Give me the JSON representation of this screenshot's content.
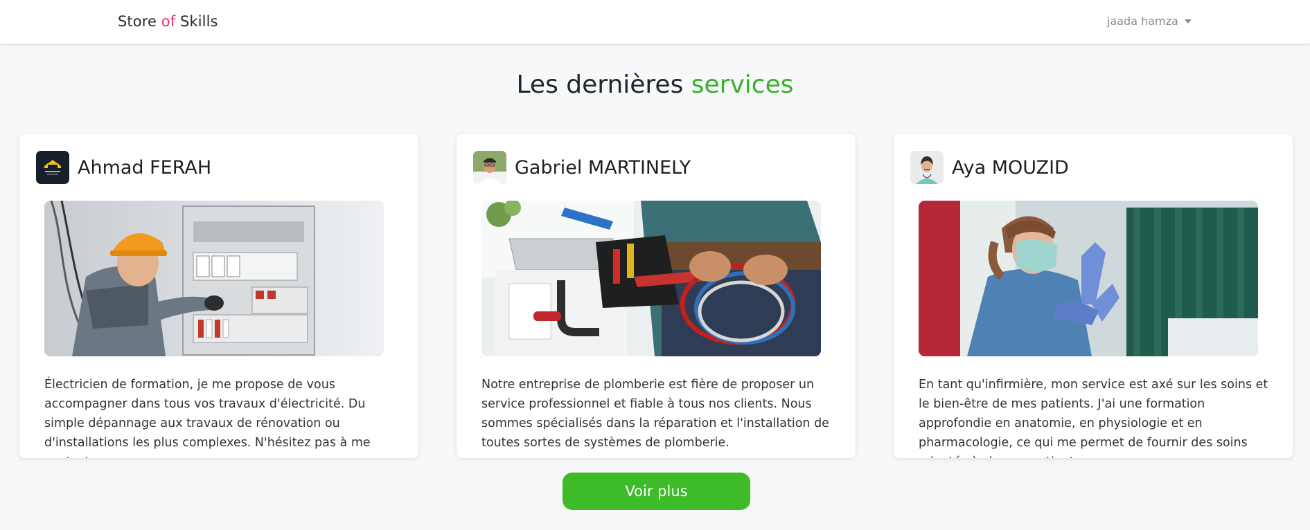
{
  "navbar": {
    "brand_part1": "Store ",
    "brand_accent": "of",
    "brand_part2": " Skills",
    "user_name": "jaada hamza",
    "brand_accent_color": "#e8316f"
  },
  "section": {
    "title_part1": "Les dernières ",
    "title_accent": "services",
    "accent_color": "#3dae2b"
  },
  "cards": [
    {
      "name": "Ahmad FERAH",
      "avatar": "company-logo-icon",
      "image": "electrician-photo",
      "description": "Électricien de formation, je me propose de vous accompagner dans tous vos travaux d'électricité. Du simple dépannage aux travaux de rénovation ou d'installations les plus complexes. N'hésitez pas à me contacter"
    },
    {
      "name": "Gabriel MARTINELY",
      "avatar": "person-photo-icon",
      "image": "plumber-photo",
      "description": "Notre entreprise de plomberie est fière de proposer un service professionnel et fiable à tous nos clients. Nous sommes spécialisés dans la réparation et l'installation de toutes sortes de systèmes de plomberie."
    },
    {
      "name": "Aya MOUZID",
      "avatar": "nurse-photo-icon",
      "image": "nurse-photo",
      "description": "En tant qu'infirmière, mon service est axé sur les soins et le bien-être de mes patients. J'ai une formation approfondie en anatomie, en physiologie et en pharmacologie, ce qui me permet de fournir des soins adaptés à chaque patient."
    }
  ],
  "button": {
    "label": "Voir plus",
    "color": "#3dbb28"
  }
}
